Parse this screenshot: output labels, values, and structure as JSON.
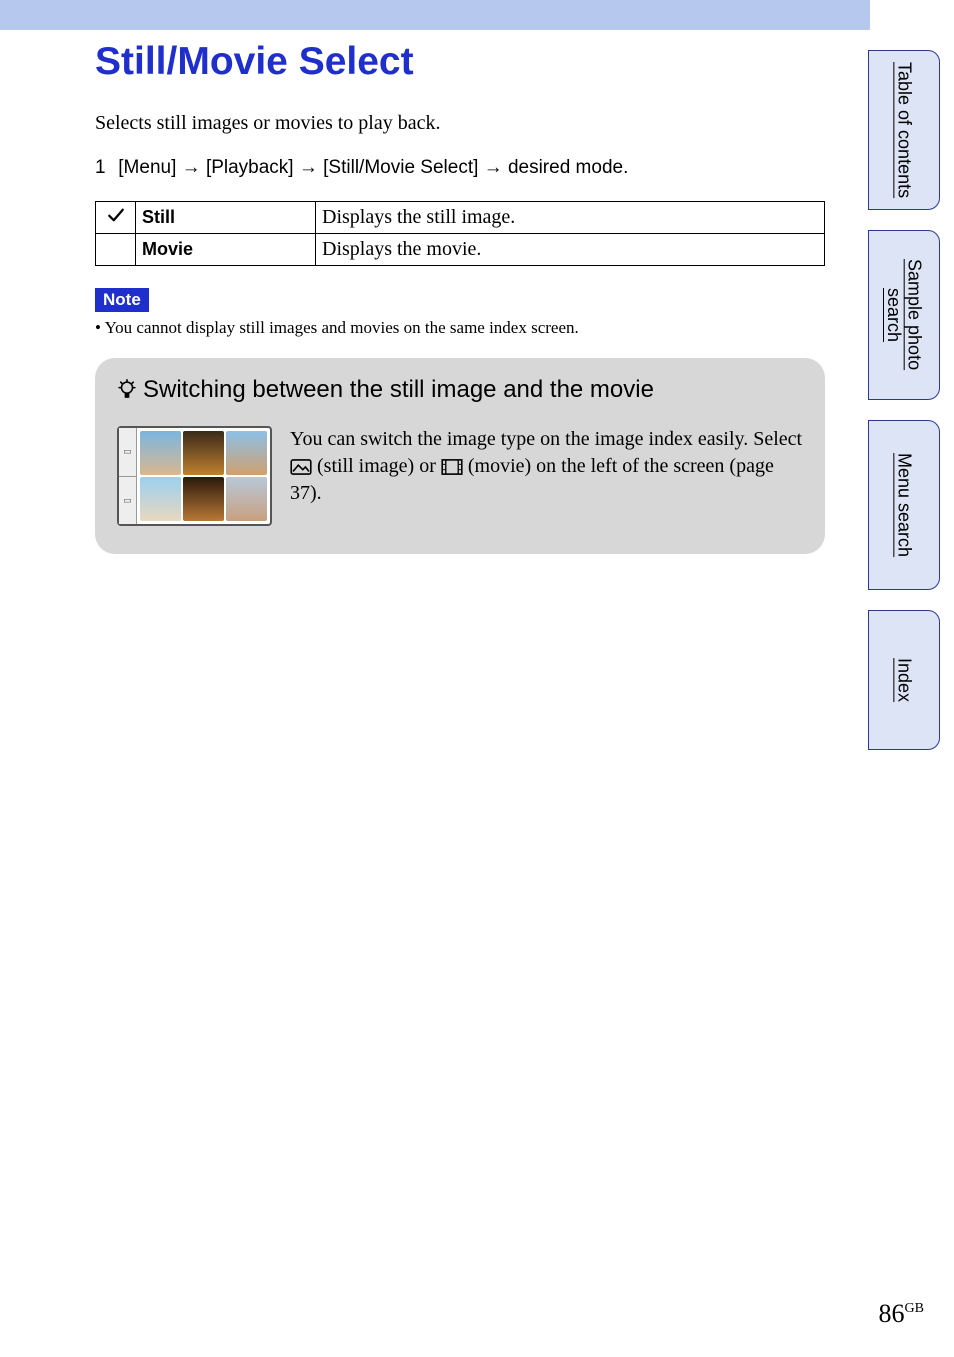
{
  "title": "Still/Movie Select",
  "intro": "Selects still images or movies to play back.",
  "step": {
    "num": "1",
    "parts": [
      "[Menu]",
      "[Playback]",
      "[Still/Movie Select]",
      "desired mode."
    ]
  },
  "table": {
    "rows": [
      {
        "label": "Still",
        "desc": "Displays the still image.",
        "checked": true
      },
      {
        "label": "Movie",
        "desc": "Displays the movie.",
        "checked": false
      }
    ]
  },
  "note": {
    "label": "Note",
    "items": [
      "You cannot display still images and movies on the same index screen."
    ]
  },
  "tip": {
    "title": "Switching between the still image and the movie",
    "text_before": "You can switch the image type on the image index easily. Select ",
    "still_label": " (still image) or ",
    "movie_label": " (movie) on the left of the screen (page 37)."
  },
  "sidetabs": [
    "Table of contents",
    "Sample photo search",
    "Menu search",
    "Index"
  ],
  "pagenum": {
    "num": "86",
    "suffix": "GB"
  }
}
